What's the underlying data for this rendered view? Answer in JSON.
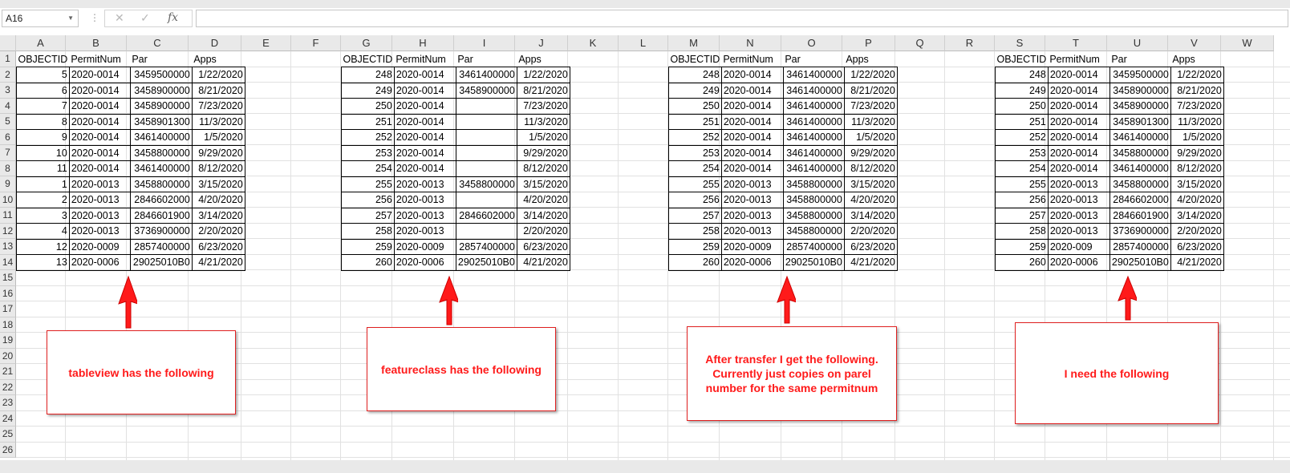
{
  "formula_bar": {
    "name_box": "A16",
    "cancel": "✕",
    "enter": "✓",
    "fx": "fx",
    "formula": ""
  },
  "columns": [
    "A",
    "B",
    "C",
    "D",
    "E",
    "F",
    "G",
    "H",
    "I",
    "J",
    "K",
    "L",
    "M",
    "N",
    "O",
    "P",
    "Q",
    "R",
    "S",
    "T",
    "U",
    "V",
    "W"
  ],
  "rows": [
    "1",
    "2",
    "3",
    "4",
    "5",
    "6",
    "7",
    "8",
    "9",
    "10",
    "11",
    "12",
    "13",
    "14",
    "15",
    "16",
    "17",
    "18",
    "19",
    "20",
    "21",
    "22",
    "23",
    "24",
    "25",
    "26"
  ],
  "headers": [
    "OBJECTID",
    "PermitNum",
    "Par",
    "Apps"
  ],
  "tables": [
    {
      "rows": [
        [
          "5",
          "2020-0014",
          "3459500000",
          "1/22/2020"
        ],
        [
          "6",
          "2020-0014",
          "3458900000",
          "8/21/2020"
        ],
        [
          "7",
          "2020-0014",
          "3458900000",
          "7/23/2020"
        ],
        [
          "8",
          "2020-0014",
          "3458901300",
          "11/3/2020"
        ],
        [
          "9",
          "2020-0014",
          "3461400000",
          "1/5/2020"
        ],
        [
          "10",
          "2020-0014",
          "3458800000",
          "9/29/2020"
        ],
        [
          "11",
          "2020-0014",
          "3461400000",
          "8/12/2020"
        ],
        [
          "1",
          "2020-0013",
          "3458800000",
          "3/15/2020"
        ],
        [
          "2",
          "2020-0013",
          "2846602000",
          "4/20/2020"
        ],
        [
          "3",
          "2020-0013",
          "2846601900",
          "3/14/2020"
        ],
        [
          "4",
          "2020-0013",
          "3736900000",
          "2/20/2020"
        ],
        [
          "12",
          "2020-0009",
          "2857400000",
          "6/23/2020"
        ],
        [
          "13",
          "2020-0006",
          "29025010B0",
          "4/21/2020"
        ]
      ]
    },
    {
      "rows": [
        [
          "248",
          "2020-0014",
          "3461400000",
          "1/22/2020"
        ],
        [
          "249",
          "2020-0014",
          "3458900000",
          "8/21/2020"
        ],
        [
          "250",
          "2020-0014",
          "",
          "7/23/2020"
        ],
        [
          "251",
          "2020-0014",
          "",
          "11/3/2020"
        ],
        [
          "252",
          "2020-0014",
          "",
          "1/5/2020"
        ],
        [
          "253",
          "2020-0014",
          "",
          "9/29/2020"
        ],
        [
          "254",
          "2020-0014",
          "",
          "8/12/2020"
        ],
        [
          "255",
          "2020-0013",
          "3458800000",
          "3/15/2020"
        ],
        [
          "256",
          "2020-0013",
          "",
          "4/20/2020"
        ],
        [
          "257",
          "2020-0013",
          "2846602000",
          "3/14/2020"
        ],
        [
          "258",
          "2020-0013",
          "",
          "2/20/2020"
        ],
        [
          "259",
          "2020-0009",
          "2857400000",
          "6/23/2020"
        ],
        [
          "260",
          "2020-0006",
          "29025010B0",
          "4/21/2020"
        ]
      ]
    },
    {
      "rows": [
        [
          "248",
          "2020-0014",
          "3461400000",
          "1/22/2020"
        ],
        [
          "249",
          "2020-0014",
          "3461400000",
          "8/21/2020"
        ],
        [
          "250",
          "2020-0014",
          "3461400000",
          "7/23/2020"
        ],
        [
          "251",
          "2020-0014",
          "3461400000",
          "11/3/2020"
        ],
        [
          "252",
          "2020-0014",
          "3461400000",
          "1/5/2020"
        ],
        [
          "253",
          "2020-0014",
          "3461400000",
          "9/29/2020"
        ],
        [
          "254",
          "2020-0014",
          "3461400000",
          "8/12/2020"
        ],
        [
          "255",
          "2020-0013",
          "3458800000",
          "3/15/2020"
        ],
        [
          "256",
          "2020-0013",
          "3458800000",
          "4/20/2020"
        ],
        [
          "257",
          "2020-0013",
          "3458800000",
          "3/14/2020"
        ],
        [
          "258",
          "2020-0013",
          "3458800000",
          "2/20/2020"
        ],
        [
          "259",
          "2020-0009",
          "2857400000",
          "6/23/2020"
        ],
        [
          "260",
          "2020-0006",
          "29025010B0",
          "4/21/2020"
        ]
      ]
    },
    {
      "rows": [
        [
          "248",
          "2020-0014",
          "3459500000",
          "1/22/2020"
        ],
        [
          "249",
          "2020-0014",
          "3458900000",
          "8/21/2020"
        ],
        [
          "250",
          "2020-0014",
          "3458900000",
          "7/23/2020"
        ],
        [
          "251",
          "2020-0014",
          "3458901300",
          "11/3/2020"
        ],
        [
          "252",
          "2020-0014",
          "3461400000",
          "1/5/2020"
        ],
        [
          "253",
          "2020-0014",
          "3458800000",
          "9/29/2020"
        ],
        [
          "254",
          "2020-0014",
          "3461400000",
          "8/12/2020"
        ],
        [
          "255",
          "2020-0013",
          "3458800000",
          "3/15/2020"
        ],
        [
          "256",
          "2020-0013",
          "2846602000",
          "4/20/2020"
        ],
        [
          "257",
          "2020-0013",
          "2846601900",
          "3/14/2020"
        ],
        [
          "258",
          "2020-0013",
          "3736900000",
          "2/20/2020"
        ],
        [
          "259",
          "2020-009",
          "2857400000",
          "6/23/2020"
        ],
        [
          "260",
          "2020-0006",
          "29025010B0",
          "4/21/2020"
        ]
      ]
    }
  ],
  "notes": [
    "tableview has the following",
    "featureclass has the following",
    "After transfer I get the following. Currently just copies on parel number for the same permitnum",
    "I need the following"
  ],
  "colors": {
    "annotation": "#ff1a1a",
    "header_bg": "#e9e9e9"
  }
}
